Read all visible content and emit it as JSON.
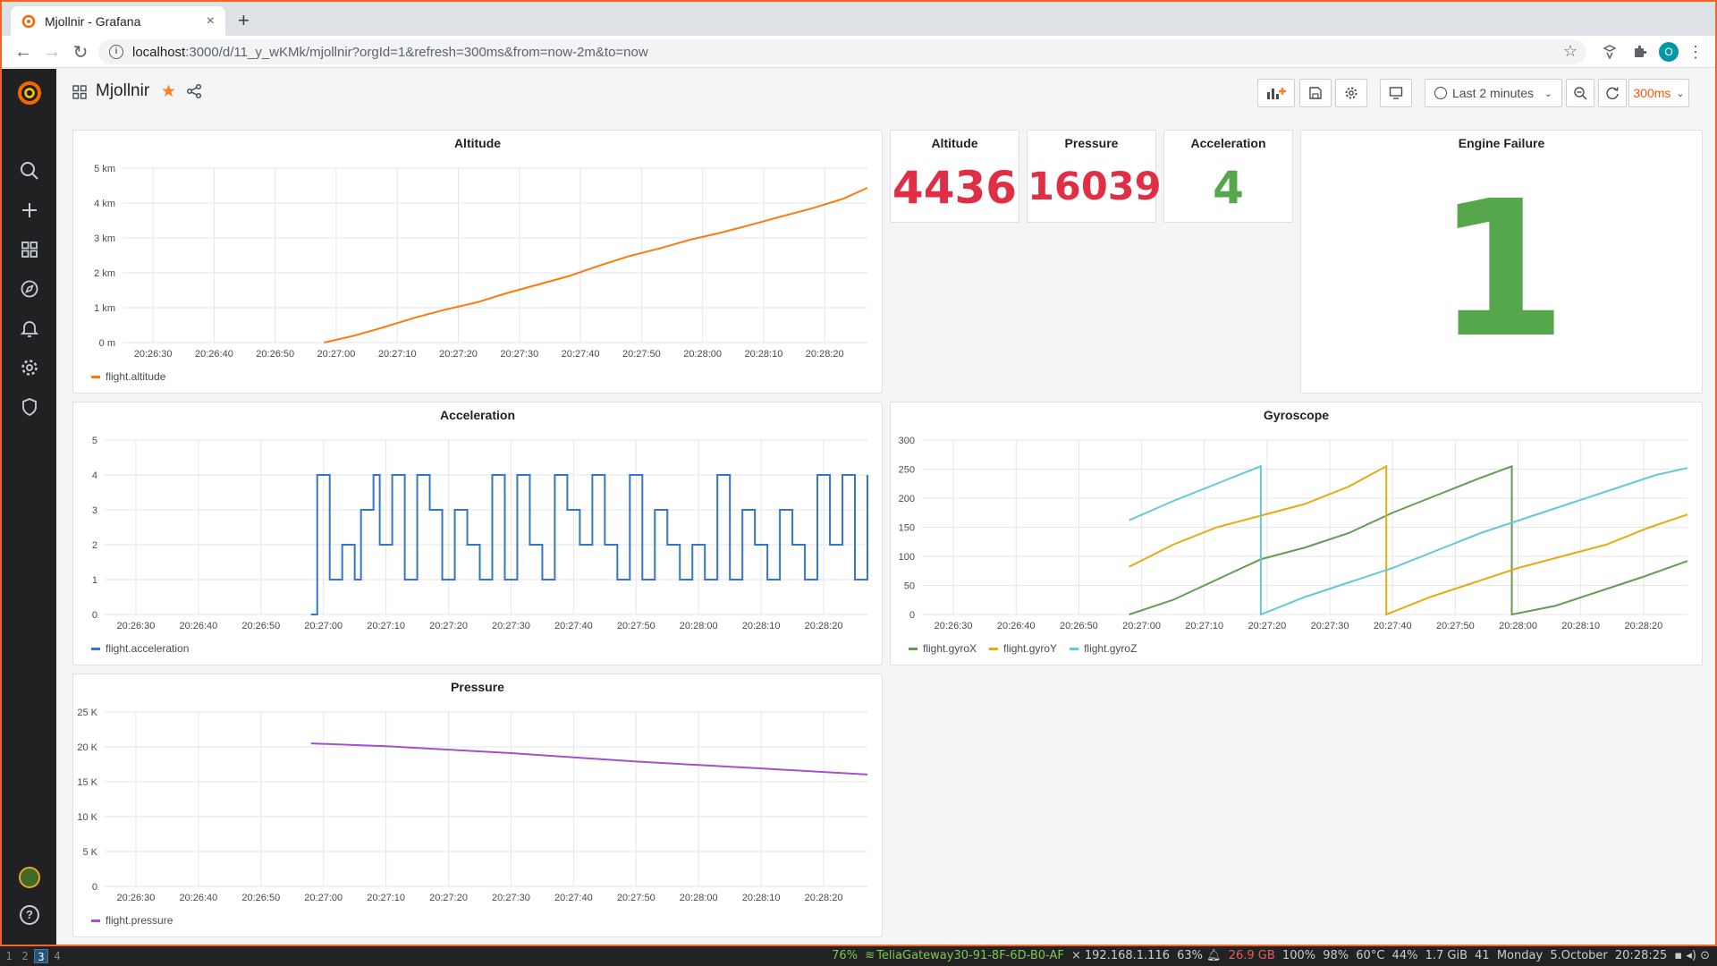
{
  "browser": {
    "tab_title": "Mjollnir - Grafana",
    "tab_close": "×",
    "new_tab": "+",
    "url_host": "localhost",
    "url_path": ":3000/d/11_y_wKMk/mjollnir?orgId=1&refresh=300ms&from=now-2m&to=now",
    "profile_initial": "O"
  },
  "dashboard": {
    "title": "Mjollnir",
    "time_range": "Last 2 minutes",
    "refresh": "300ms"
  },
  "stats": {
    "altitude": {
      "title": "Altitude",
      "value": "4436",
      "color": "#e02f44"
    },
    "pressure": {
      "title": "Pressure",
      "value": "16039",
      "color": "#e02f44"
    },
    "acceleration": {
      "title": "Acceleration",
      "value": "4",
      "color": "#56a64b"
    },
    "engine_failure": {
      "title": "Engine Failure",
      "value": "1",
      "color": "#56a64b"
    }
  },
  "chart_data": [
    {
      "type": "line",
      "title": "Altitude",
      "x_ticks": [
        "20:26:30",
        "20:26:40",
        "20:26:50",
        "20:27:00",
        "20:27:10",
        "20:27:20",
        "20:27:30",
        "20:27:40",
        "20:27:50",
        "20:28:00",
        "20:28:10",
        "20:28:20"
      ],
      "y_ticks": [
        "0 m",
        "1 km",
        "2 km",
        "3 km",
        "4 km",
        "5 km"
      ],
      "ylim": [
        0,
        5000
      ],
      "xlim": [
        "20:26:25",
        "20:28:27"
      ],
      "series": [
        {
          "name": "flight.altitude",
          "color": "#ff780a",
          "x": [
            "20:26:58",
            "20:27:03",
            "20:27:08",
            "20:27:13",
            "20:27:18",
            "20:27:23",
            "20:27:28",
            "20:27:33",
            "20:27:38",
            "20:27:43",
            "20:27:48",
            "20:27:53",
            "20:27:58",
            "20:28:03",
            "20:28:08",
            "20:28:13",
            "20:28:18",
            "20:28:23",
            "20:28:27"
          ],
          "y": [
            0,
            200,
            450,
            720,
            950,
            1150,
            1420,
            1660,
            1900,
            2200,
            2480,
            2700,
            2950,
            3150,
            3380,
            3620,
            3850,
            4120,
            4436
          ]
        }
      ],
      "legend_position": "bottom-left"
    },
    {
      "type": "line",
      "title": "Acceleration",
      "x_ticks": [
        "20:26:30",
        "20:26:40",
        "20:26:50",
        "20:27:00",
        "20:27:10",
        "20:27:20",
        "20:27:30",
        "20:27:40",
        "20:27:50",
        "20:28:00",
        "20:28:10",
        "20:28:20"
      ],
      "y_ticks": [
        "0",
        "1",
        "2",
        "3",
        "4",
        "5"
      ],
      "ylim": [
        0,
        5
      ],
      "xlim": [
        "20:26:25",
        "20:28:27"
      ],
      "series": [
        {
          "name": "flight.acceleration",
          "color": "#3274d9",
          "x": [
            "20:26:58",
            "20:26:59",
            "20:27:01",
            "20:27:03",
            "20:27:05",
            "20:27:06",
            "20:27:08",
            "20:27:09",
            "20:27:11",
            "20:27:13",
            "20:27:15",
            "20:27:17",
            "20:27:19",
            "20:27:21",
            "20:27:23",
            "20:27:25",
            "20:27:27",
            "20:27:29",
            "20:27:31",
            "20:27:33",
            "20:27:35",
            "20:27:37",
            "20:27:39",
            "20:27:41",
            "20:27:43",
            "20:27:45",
            "20:27:47",
            "20:27:49",
            "20:27:51",
            "20:27:53",
            "20:27:55",
            "20:27:57",
            "20:27:59",
            "20:28:01",
            "20:28:03",
            "20:28:05",
            "20:28:07",
            "20:28:09",
            "20:28:11",
            "20:28:13",
            "20:28:15",
            "20:28:17",
            "20:28:19",
            "20:28:21",
            "20:28:23",
            "20:28:25",
            "20:28:27"
          ],
          "y": [
            0,
            4,
            1,
            2,
            1,
            3,
            4,
            2,
            4,
            1,
            4,
            3,
            1,
            3,
            2,
            1,
            4,
            1,
            4,
            2,
            1,
            4,
            3,
            2,
            4,
            2,
            1,
            4,
            1,
            3,
            2,
            1,
            2,
            1,
            4,
            1,
            3,
            2,
            1,
            3,
            2,
            1,
            4,
            2,
            4,
            1,
            4
          ]
        }
      ],
      "legend_position": "bottom-left"
    },
    {
      "type": "line",
      "title": "Gyroscope",
      "x_ticks": [
        "20:26:30",
        "20:26:40",
        "20:26:50",
        "20:27:00",
        "20:27:10",
        "20:27:20",
        "20:27:30",
        "20:27:40",
        "20:27:50",
        "20:28:00",
        "20:28:10",
        "20:28:20"
      ],
      "y_ticks": [
        "0",
        "50",
        "100",
        "150",
        "200",
        "250",
        "300"
      ],
      "ylim": [
        0,
        300
      ],
      "xlim": [
        "20:26:25",
        "20:28:27"
      ],
      "series": [
        {
          "name": "flight.gyroX",
          "color": "#629e51",
          "x": [
            "20:26:58",
            "20:27:05",
            "20:27:12",
            "20:27:19",
            "20:27:26",
            "20:27:33",
            "20:27:40",
            "20:27:47",
            "20:27:54",
            "20:27:59",
            "20:27:59",
            "20:28:06",
            "20:28:13",
            "20:28:20",
            "20:28:27"
          ],
          "y": [
            0,
            25,
            60,
            95,
            115,
            140,
            175,
            205,
            235,
            255,
            0,
            15,
            40,
            65,
            92
          ]
        },
        {
          "name": "flight.gyroY",
          "color": "#e5ac0e",
          "x": [
            "20:26:58",
            "20:27:05",
            "20:27:12",
            "20:27:19",
            "20:27:26",
            "20:27:33",
            "20:27:39",
            "20:27:39",
            "20:27:46",
            "20:27:53",
            "20:28:00",
            "20:28:07",
            "20:28:14",
            "20:28:21",
            "20:28:27"
          ],
          "y": [
            82,
            120,
            150,
            170,
            190,
            220,
            255,
            0,
            30,
            55,
            80,
            100,
            120,
            150,
            172
          ]
        },
        {
          "name": "flight.gyroZ",
          "color": "#64c8d8",
          "x": [
            "20:26:58",
            "20:27:05",
            "20:27:12",
            "20:27:19",
            "20:27:19",
            "20:27:26",
            "20:27:33",
            "20:27:40",
            "20:27:47",
            "20:27:54",
            "20:28:01",
            "20:28:08",
            "20:28:15",
            "20:28:22",
            "20:28:27"
          ],
          "y": [
            162,
            195,
            225,
            255,
            0,
            30,
            55,
            80,
            110,
            140,
            165,
            190,
            215,
            240,
            252
          ]
        }
      ],
      "legend_position": "bottom-left"
    },
    {
      "type": "line",
      "title": "Pressure",
      "x_ticks": [
        "20:26:30",
        "20:26:40",
        "20:26:50",
        "20:27:00",
        "20:27:10",
        "20:27:20",
        "20:27:30",
        "20:27:40",
        "20:27:50",
        "20:28:00",
        "20:28:10",
        "20:28:20"
      ],
      "y_ticks": [
        "0",
        "5 K",
        "10 K",
        "15 K",
        "20 K",
        "25 K"
      ],
      "ylim": [
        0,
        25000
      ],
      "xlim": [
        "20:26:25",
        "20:28:27"
      ],
      "series": [
        {
          "name": "flight.pressure",
          "color": "#a352cc",
          "x": [
            "20:26:58",
            "20:27:10",
            "20:27:20",
            "20:27:30",
            "20:27:40",
            "20:27:50",
            "20:28:00",
            "20:28:10",
            "20:28:20",
            "20:28:27"
          ],
          "y": [
            20500,
            20100,
            19600,
            19100,
            18500,
            17900,
            17400,
            16900,
            16400,
            16039
          ]
        }
      ],
      "legend_position": "bottom-left"
    }
  ],
  "taskbar": {
    "workspaces": [
      "1",
      "2",
      "3",
      "4"
    ],
    "active_workspace": "3",
    "battery_pct": "76%",
    "wifi": "TeliaGateway30-91-8F-6D-B0-AF",
    "ip": "192.168.1.116",
    "cpu": "63%",
    "disk": "26.9 GB",
    "brightness": "100%",
    "volume_battery": "98%",
    "temp": "60°C",
    "load": "44%",
    "mem": "1.7 GiB",
    "procs": "41",
    "day": "Monday",
    "date": "5.October",
    "time": "20:28:25"
  }
}
